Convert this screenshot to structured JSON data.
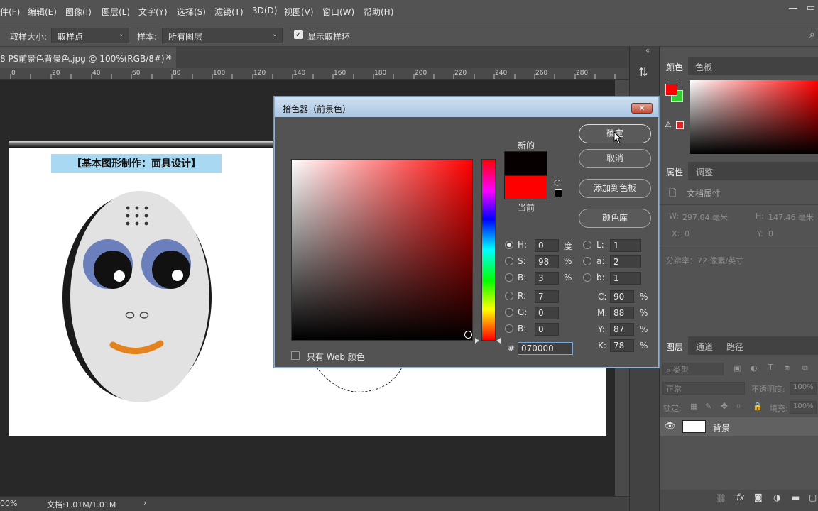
{
  "menubar": {
    "items": [
      "件(F)",
      "编辑(E)",
      "图像(I)",
      "图层(L)",
      "文字(Y)",
      "选择(S)",
      "滤镜(T)",
      "3D(D)",
      "视图(V)",
      "窗口(W)",
      "帮助(H)"
    ]
  },
  "options": {
    "sample_size_label": "取样大小:",
    "sample_size_value": "取样点",
    "sample_label": "样本:",
    "sample_value": "所有图层",
    "show_ring_label": "显示取样环"
  },
  "document": {
    "tab_title": "8 PS前景色背景色.jpg @ 100%(RGB/8#) *",
    "ruler_ticks": [
      "0",
      "20",
      "40",
      "60",
      "80",
      "100",
      "120",
      "140",
      "160",
      "180",
      "200",
      "220",
      "240",
      "260",
      "280"
    ],
    "canvas_title": "【基本图形制作：面具设计】"
  },
  "status": {
    "zoom": "00%",
    "doc_info": "文档:1.01M/1.01M"
  },
  "panels": {
    "color_tabs": [
      "颜色",
      "色板"
    ],
    "properties_tabs": [
      "属性",
      "调整"
    ],
    "doc_props_title": "文档属性",
    "w_label": "W:",
    "w_value": "297.04 毫米",
    "h_label": "H:",
    "h_value": "147.46 毫米",
    "x_label": "X:",
    "x_value": "0",
    "y_label": "Y:",
    "y_value": "0",
    "resolution": "分辨率：72 像素/英寸",
    "layers_tabs": [
      "图层",
      "通道",
      "路径"
    ],
    "kind_placeholder": "类型",
    "blend_mode": "正常",
    "opacity_label": "不透明度:",
    "opacity_value": "100%",
    "lock_label": "锁定:",
    "fill_label": "填充:",
    "fill_value": "100%",
    "layer_name": "背景"
  },
  "dialog": {
    "title": "拾色器（前景色）",
    "new_label": "新的",
    "current_label": "当前",
    "new_color": "#070000",
    "current_color": "#ff0000",
    "web_only_label": "只有 Web 颜色",
    "buttons": {
      "ok": "确定",
      "cancel": "取消",
      "add_swatch": "添加到色板",
      "libraries": "颜色库"
    },
    "fields": {
      "H": {
        "label": "H:",
        "value": "0",
        "unit": "度"
      },
      "S": {
        "label": "S:",
        "value": "98",
        "unit": "%"
      },
      "B": {
        "label": "B:",
        "value": "3",
        "unit": "%"
      },
      "R": {
        "label": "R:",
        "value": "7"
      },
      "G": {
        "label": "G:",
        "value": "0"
      },
      "Bb": {
        "label": "B:",
        "value": "0"
      },
      "L": {
        "label": "L:",
        "value": "1"
      },
      "a": {
        "label": "a:",
        "value": "2"
      },
      "b": {
        "label": "b:",
        "value": "1"
      },
      "C": {
        "label": "C:",
        "value": "90",
        "unit": "%"
      },
      "M": {
        "label": "M:",
        "value": "88",
        "unit": "%"
      },
      "Y": {
        "label": "Y:",
        "value": "87",
        "unit": "%"
      },
      "K": {
        "label": "K:",
        "value": "78",
        "unit": "%"
      }
    },
    "hex_label": "#",
    "hex_value": "070000"
  },
  "colors": {
    "foreground": "#ff0000",
    "background": "#33cc33",
    "mask_eye": "#6b7fbd",
    "mouth": "#e38320"
  }
}
